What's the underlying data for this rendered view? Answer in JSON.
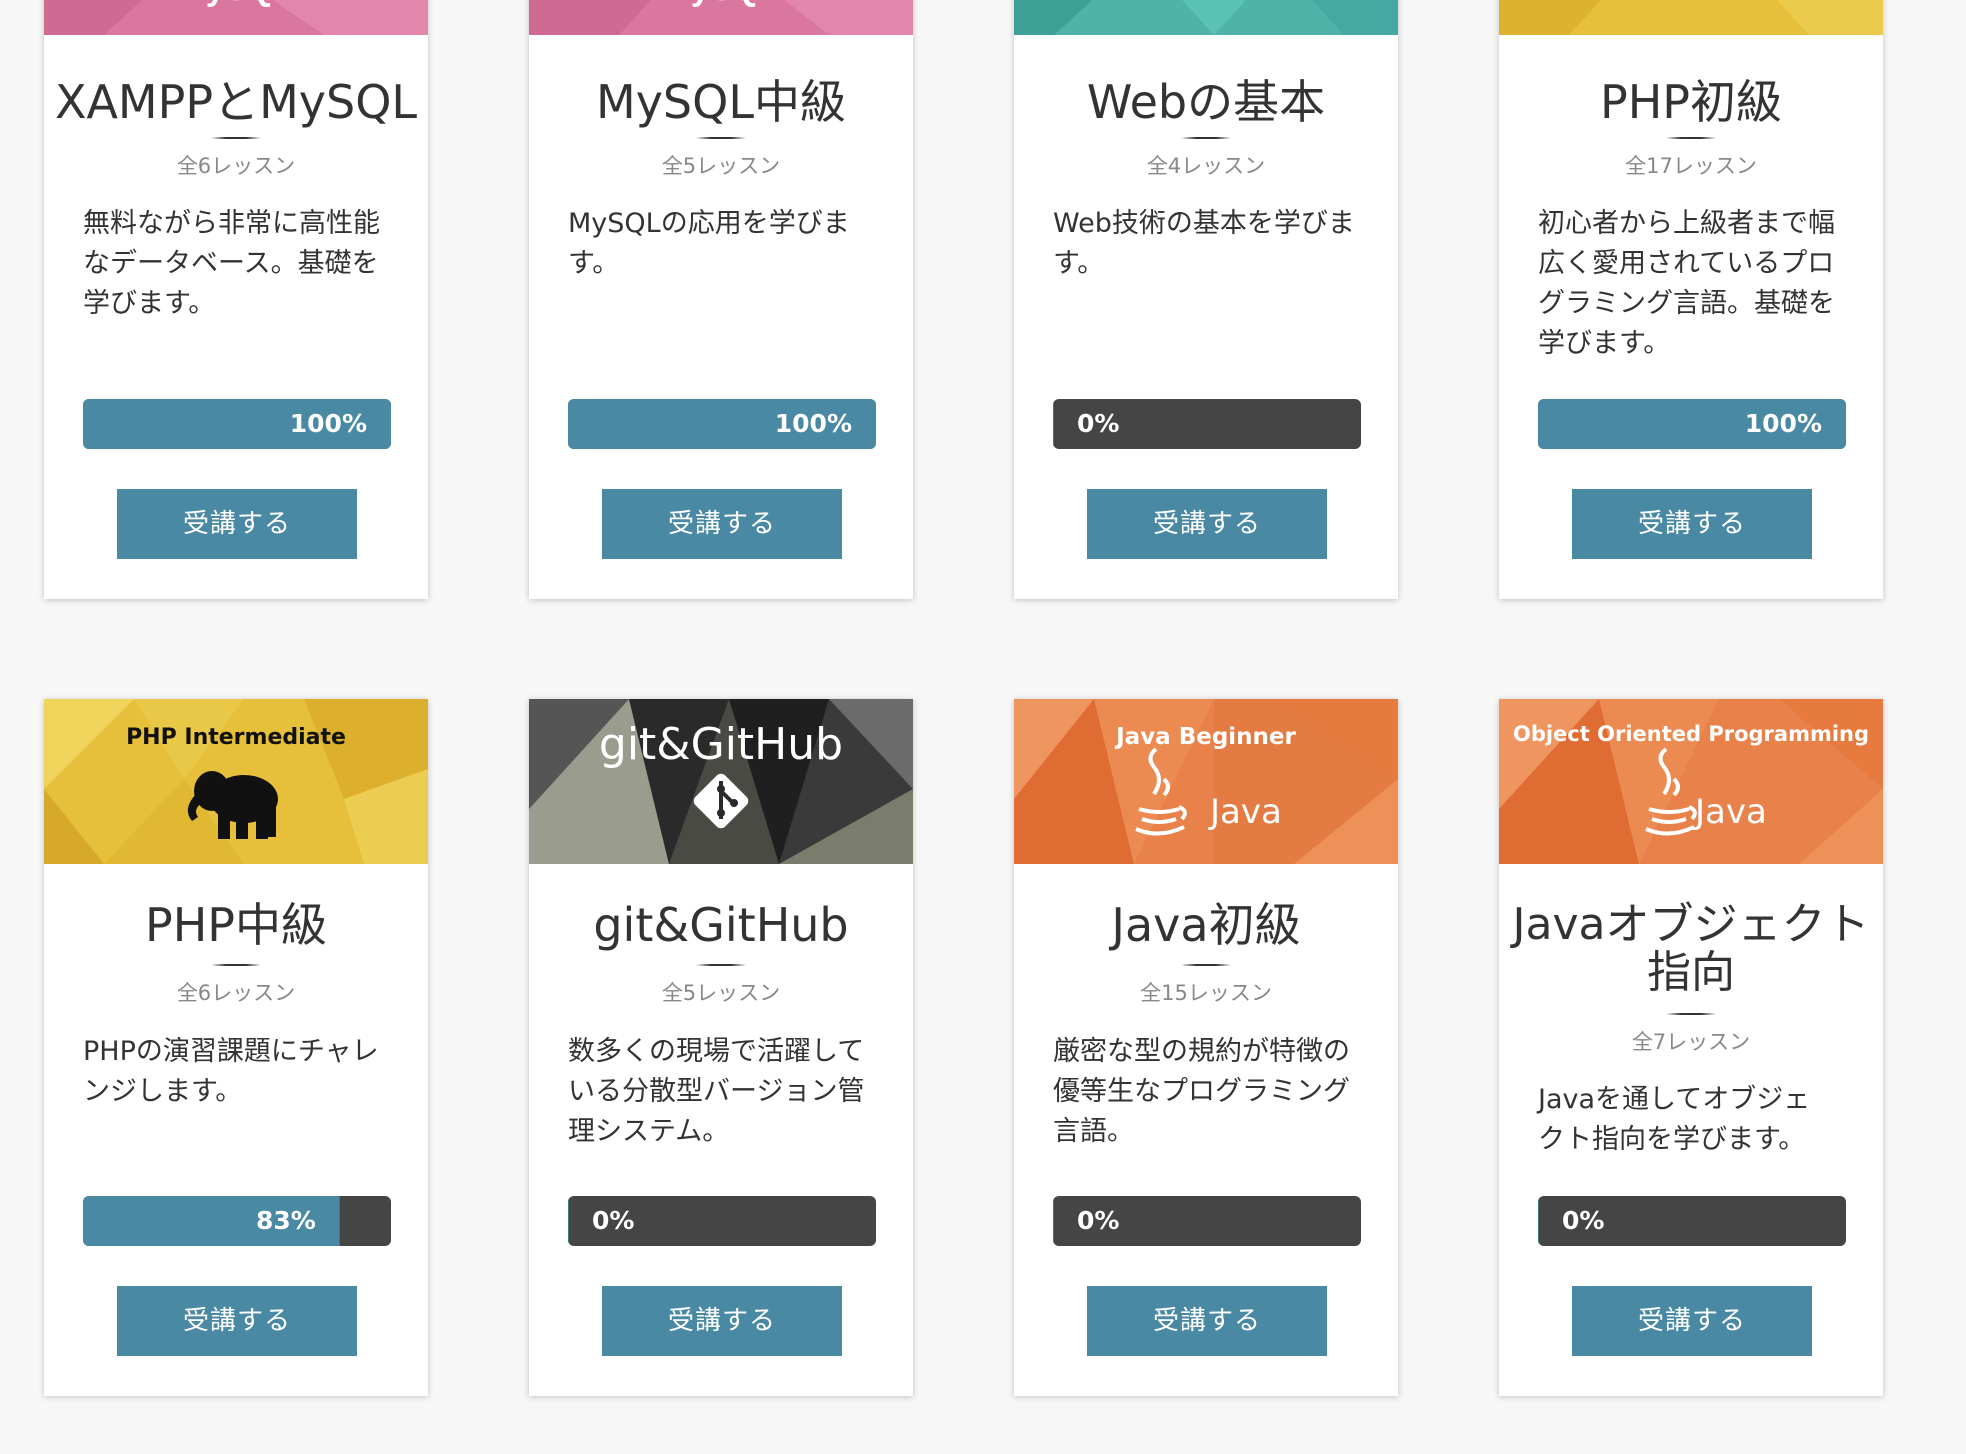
{
  "courses": [
    {
      "title": "XAMPPとMySQL",
      "lessons": "全6レッスン",
      "description": "無料ながら非常に高性能なデータベース。基礎を学びます。",
      "progress_label": "100%",
      "progress": 100,
      "button": "受講する",
      "banner_text": "MySQL"
    },
    {
      "title": "MySQL中級",
      "lessons": "全5レッスン",
      "description": "MySQLの応用を学びます。",
      "progress_label": "100%",
      "progress": 100,
      "button": "受講する",
      "banner_text": "MySQL"
    },
    {
      "title": "Webの基本",
      "lessons": "全4レッスン",
      "description": "Web技術の基本を学びます。",
      "progress_label": "0%",
      "progress": 0,
      "button": "受講する"
    },
    {
      "title": "PHP初級",
      "lessons": "全17レッスン",
      "description": "初心者から上級者まで幅広く愛用されているプログラミング言語。基礎を学びます。",
      "progress_label": "100%",
      "progress": 100,
      "button": "受講する"
    },
    {
      "title": "PHP中級",
      "lessons": "全6レッスン",
      "description": "PHPの演習課題にチャレンジします。",
      "progress_label": "83%",
      "progress": 83,
      "button": "受講する",
      "banner_text": "PHP Intermediate"
    },
    {
      "title": "git&GitHub",
      "lessons": "全5レッスン",
      "description": "数多くの現場で活躍している分散型バージョン管理システム。",
      "progress_label": "0%",
      "progress": 0,
      "button": "受講する",
      "banner_text": "git&GitHub"
    },
    {
      "title": "Java初級",
      "lessons": "全15レッスン",
      "description": "厳密な型の規約が特徴の優等生なプログラミング言語。",
      "progress_label": "0%",
      "progress": 0,
      "button": "受講する",
      "banner_text": "Java Beginner",
      "banner_logo": "Java"
    },
    {
      "title": "Javaオブジェクト指向",
      "lessons": "全7レッスン",
      "description": "Javaを通してオブジェクト指向を学びます。",
      "progress_label": "0%",
      "progress": 0,
      "button": "受講する",
      "banner_text": "Object Oriented Programming",
      "banner_logo": "Java"
    }
  ],
  "colors": {
    "accent": "#4a89a3",
    "progress_track": "#454545",
    "page_bg": "#f7f7f7",
    "mysql_banner": "#d9779f",
    "web_banner": "#4fb3a9",
    "php_banner": "#e6c03a",
    "git_banner": "#3a3a3a",
    "java_banner": "#e8824a"
  },
  "icons": {
    "php": "elephant-icon",
    "git": "git-diamond-icon",
    "java": "java-cup-icon"
  }
}
